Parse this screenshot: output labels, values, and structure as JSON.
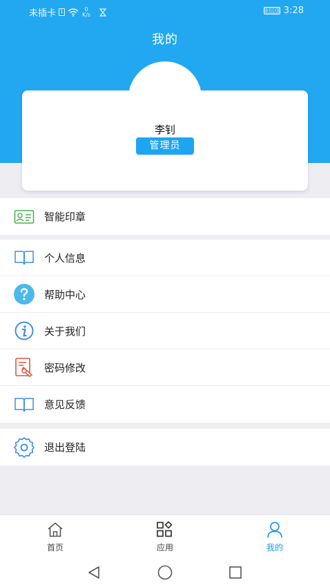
{
  "status_bar": {
    "carrier": "未插卡",
    "sim_label": "1",
    "net_speed_value": "0",
    "net_speed_unit": "K/s",
    "battery_level": "100",
    "time": "3:28"
  },
  "header": {
    "title": "我的"
  },
  "profile": {
    "name": "李钊",
    "role": "管理员"
  },
  "menu": {
    "group1": [
      {
        "label": "智能印章",
        "icon": "seal-card-icon"
      }
    ],
    "group2": [
      {
        "label": "个人信息",
        "icon": "info-book-icon"
      },
      {
        "label": "帮助中心",
        "icon": "help-icon"
      },
      {
        "label": "关于我们",
        "icon": "about-info-icon"
      },
      {
        "label": "密码修改",
        "icon": "password-edit-icon"
      },
      {
        "label": "意见反馈",
        "icon": "feedback-book-icon"
      }
    ],
    "group3": [
      {
        "label": "退出登陆",
        "icon": "settings-gear-icon"
      }
    ]
  },
  "bottom_nav": {
    "items": [
      {
        "label": "首页",
        "icon": "home-icon",
        "active": false
      },
      {
        "label": "应用",
        "icon": "apps-grid-icon",
        "active": false
      },
      {
        "label": "我的",
        "icon": "user-icon",
        "active": true
      }
    ]
  },
  "colors": {
    "primary": "#22a8f1",
    "badge": "#1ea5f0",
    "active_nav": "#1a9be8",
    "background": "#eeeef2"
  }
}
